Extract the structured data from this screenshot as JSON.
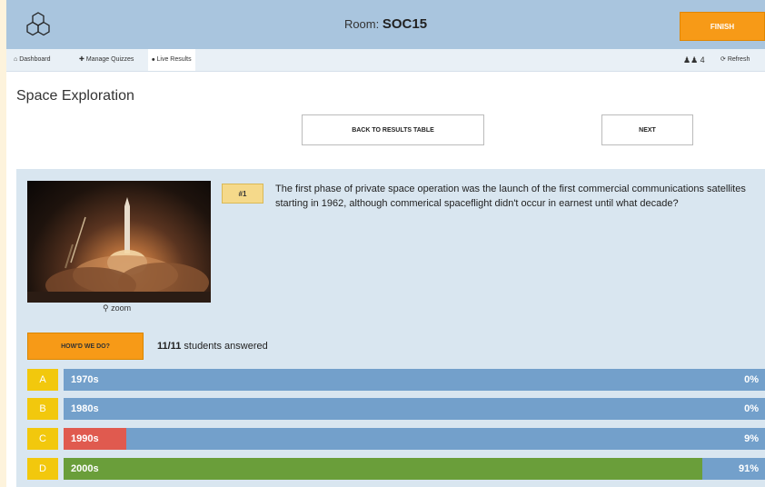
{
  "header": {
    "room_label": "Room:",
    "room_code": "SOC15",
    "finish_label": "FINISH"
  },
  "nav": {
    "items": [
      {
        "icon": "home-icon",
        "label": "Dashboard"
      },
      {
        "icon": "wrench-icon",
        "label": "Manage Quizzes"
      },
      {
        "icon": "broadcast-icon",
        "label": "Live Results"
      }
    ],
    "user_count": "4",
    "refresh_label": "Refresh"
  },
  "quiz": {
    "title": "Space Exploration",
    "back_label": "BACK TO RESULTS TABLE",
    "next_label": "NEXT"
  },
  "question": {
    "number": "#1",
    "text": "The first phase of private space operation was the launch of the first commercial communications satellites starting in 1962, although commerical spaceflight didn't occur in earnest until what decade?",
    "zoom_label": "zoom",
    "howd_label": "HOW'D WE DO?",
    "answered_count": "11/11",
    "answered_suffix": "students answered"
  },
  "answers": [
    {
      "letter": "A",
      "label": "1970s",
      "percent": 0,
      "percent_text": "0%",
      "fill_color": "#73a0cb"
    },
    {
      "letter": "B",
      "label": "1980s",
      "percent": 0,
      "percent_text": "0%",
      "fill_color": "#73a0cb"
    },
    {
      "letter": "C",
      "label": "1990s",
      "percent": 9,
      "percent_text": "9%",
      "fill_color": "#e05a4f"
    },
    {
      "letter": "D",
      "label": "2000s",
      "percent": 91,
      "percent_text": "91%",
      "fill_color": "#6a9e3a"
    }
  ],
  "colors": {
    "accent_orange": "#f79a17",
    "bar_blue": "#73a0cb",
    "letter_yellow": "#f2c80d",
    "header_blue": "#a9c5de"
  }
}
